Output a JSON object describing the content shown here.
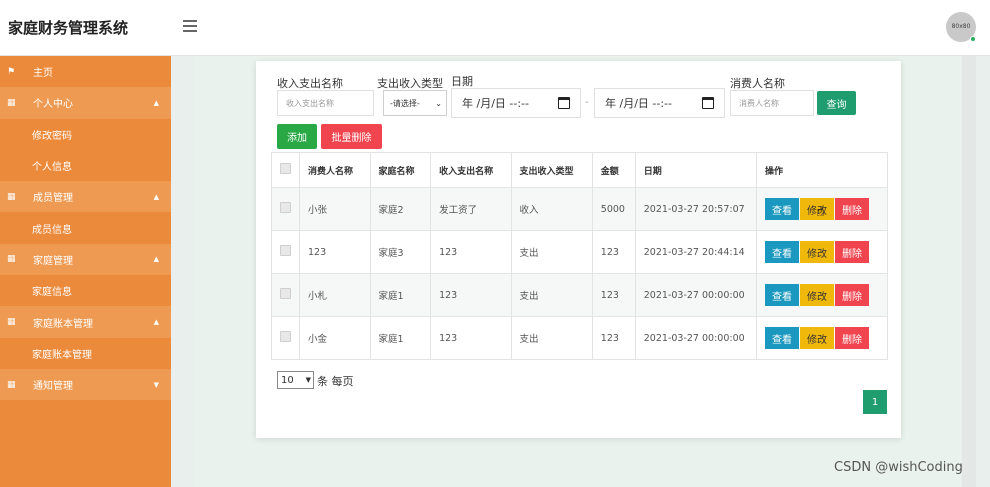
{
  "app": {
    "title": "家庭财务管理系统",
    "avatar_text": "80x80"
  },
  "sidebar": {
    "items": [
      {
        "label": "主页",
        "icon": "flag-icon",
        "type": "home"
      },
      {
        "label": "个人中心",
        "icon": "grid-icon",
        "type": "group"
      },
      {
        "label": "修改密码",
        "type": "sub"
      },
      {
        "label": "个人信息",
        "type": "sub"
      },
      {
        "label": "成员管理",
        "icon": "grid-icon",
        "type": "group"
      },
      {
        "label": "成员信息",
        "type": "sub"
      },
      {
        "label": "家庭管理",
        "icon": "grid-icon",
        "type": "group"
      },
      {
        "label": "家庭信息",
        "type": "sub"
      },
      {
        "label": "家庭账本管理",
        "icon": "grid-icon",
        "type": "group"
      },
      {
        "label": "家庭账本管理",
        "type": "sub"
      },
      {
        "label": "通知管理",
        "icon": "grid-icon",
        "type": "group"
      }
    ]
  },
  "filters": {
    "name_label": "收入支出名称",
    "name_placeholder": "收入支出名称",
    "type_label": "支出收入类型",
    "type_value": "-请选择-",
    "date_label": "日期",
    "date_start": "年 /月/日 --:--",
    "date_end": "年 /月/日 --:--",
    "date_sep": "-",
    "consumer_label": "消费人名称",
    "consumer_placeholder": "消费人名称",
    "search_label": "查询"
  },
  "actions": {
    "add_label": "添加",
    "batch_delete_label": "批量删除"
  },
  "table": {
    "headers": [
      "消费人名称",
      "家庭名称",
      "收入支出名称",
      "支出收入类型",
      "金额",
      "日期",
      "操作"
    ],
    "rows": [
      {
        "consumer": "小张",
        "family": "家庭2",
        "name": "发工资了",
        "type": "收入",
        "amount": "5000",
        "date": "2021-03-27 20:57:07"
      },
      {
        "consumer": "123",
        "family": "家庭3",
        "name": "123",
        "type": "支出",
        "amount": "123",
        "date": "2021-03-27 20:44:14"
      },
      {
        "consumer": "小札",
        "family": "家庭1",
        "name": "123",
        "type": "支出",
        "amount": "123",
        "date": "2021-03-27 00:00:00"
      },
      {
        "consumer": "小金",
        "family": "家庭1",
        "name": "123",
        "type": "支出",
        "amount": "123",
        "date": "2021-03-27 00:00:00"
      }
    ],
    "op_view": "查看",
    "op_edit": "修改",
    "op_delete": "删除"
  },
  "pagination": {
    "page_size": "10",
    "page_size_label": "条 每页",
    "current_page": "1"
  },
  "watermark": "CSDN @wishCoding",
  "colors": {
    "sidebar": "#ec8a3b",
    "search": "#1f9d6e",
    "add": "#29a846",
    "delete": "#f0444f",
    "view": "#1b98bf",
    "edit": "#f1b80c"
  }
}
